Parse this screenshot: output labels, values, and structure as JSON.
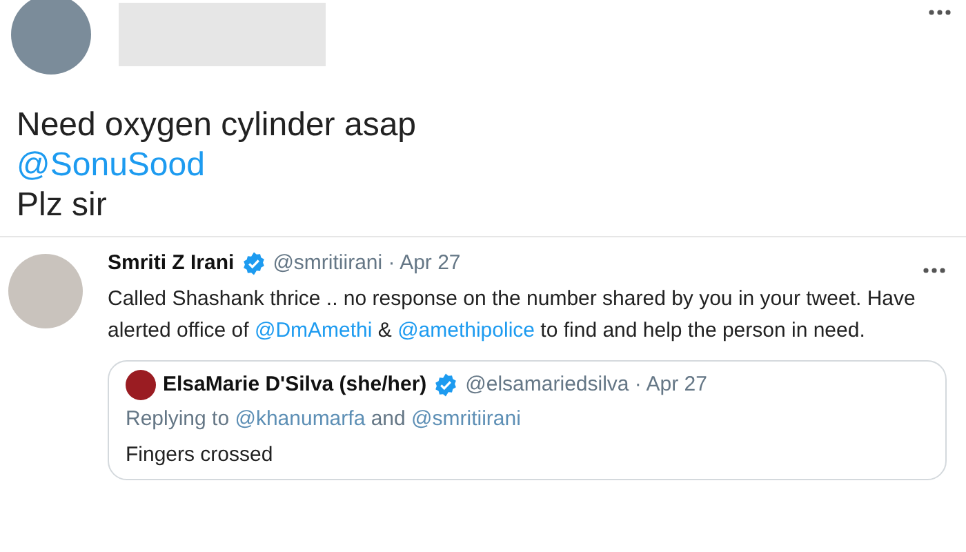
{
  "tweet": {
    "lines": [
      [
        {
          "kind": "text",
          "text": "Need oxygen cylinder asap"
        }
      ],
      [
        {
          "kind": "mention",
          "text": "@SonuSood"
        }
      ],
      [
        {
          "kind": "text",
          "text": "Plz sir"
        }
      ]
    ]
  },
  "reply": {
    "name": "Smriti Z Irani",
    "verified": true,
    "meta": "@smritiirani · Apr 27",
    "body": [
      {
        "kind": "text",
        "text": "Called Shashank thrice .. no response on the number shared by you in your tweet. Have alerted office of "
      },
      {
        "kind": "mention",
        "text": "@DmAmethi"
      },
      {
        "kind": "text",
        "text": " & "
      },
      {
        "kind": "mention",
        "text": "@amethipolice"
      },
      {
        "kind": "text",
        "text": " to find and help the person in need."
      }
    ],
    "quote": {
      "name": "ElsaMarie D'Silva (she/her)",
      "verified": true,
      "meta": "@elsamariedsilva · Apr 27",
      "replying": [
        {
          "kind": "text",
          "text": "Replying to "
        },
        {
          "kind": "mention",
          "text": "@khanumarfa"
        },
        {
          "kind": "text",
          "text": " and "
        },
        {
          "kind": "mention",
          "text": "@smritiirani"
        }
      ],
      "text": "Fingers crossed"
    }
  }
}
